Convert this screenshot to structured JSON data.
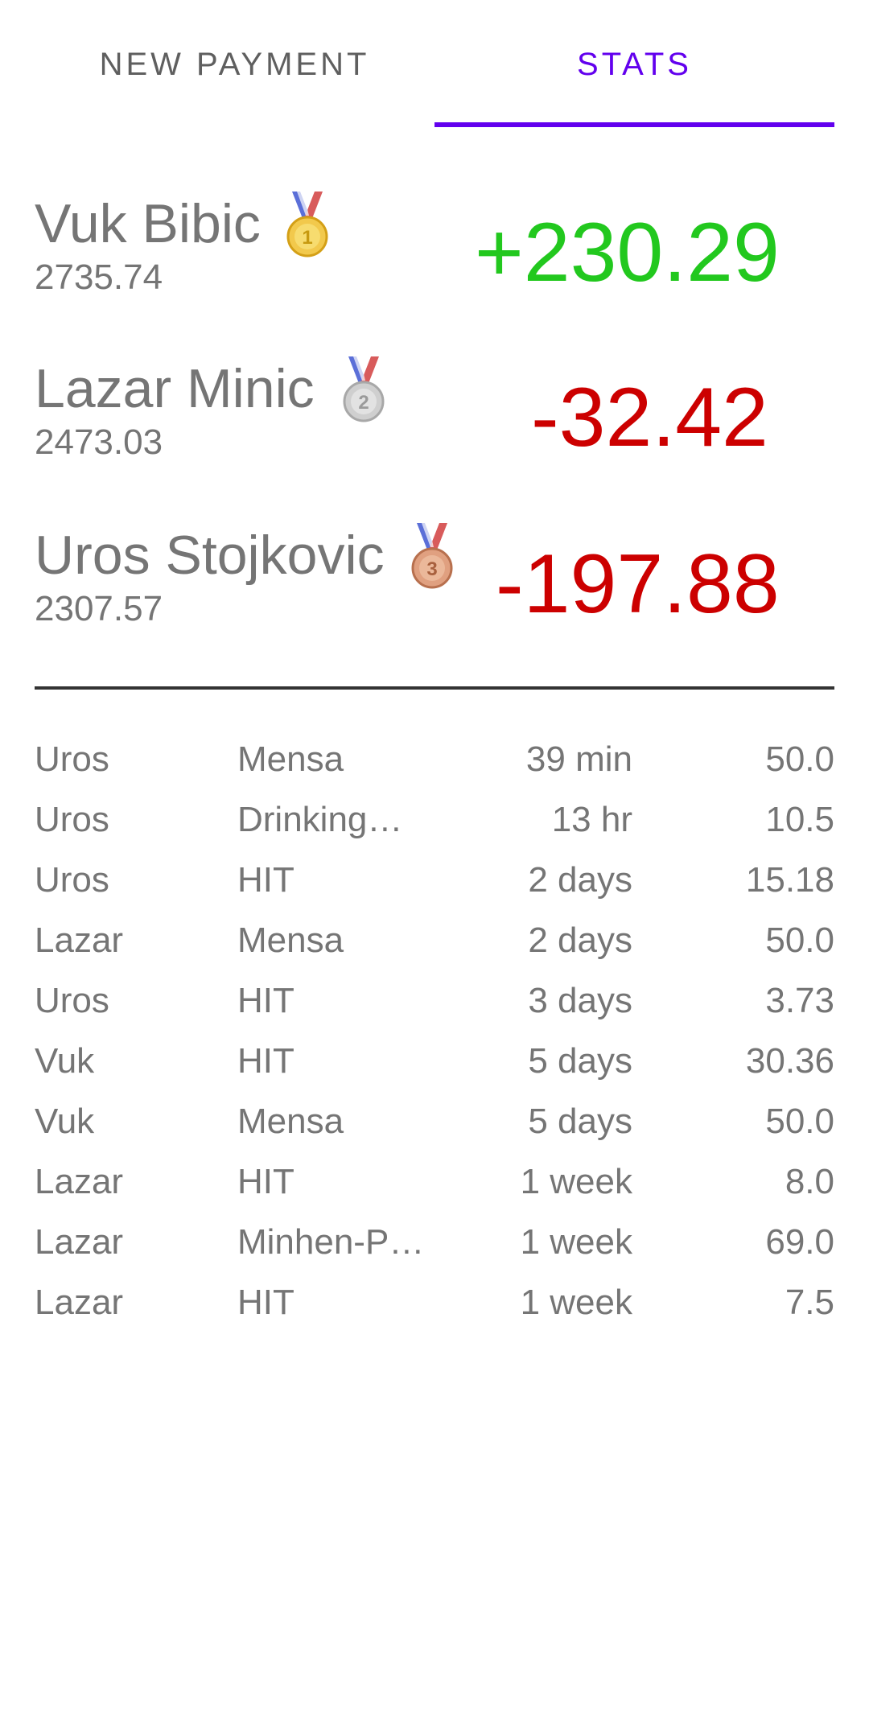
{
  "tabs": [
    {
      "label": "NEW PAYMENT",
      "selected": false
    },
    {
      "label": "STATS",
      "selected": true
    }
  ],
  "colors": {
    "accent": "#6200ee",
    "positive": "#22c81e",
    "negative": "#cc0000",
    "text": "#757575"
  },
  "leaderboard": [
    {
      "name": "Vuk Bibic",
      "total": "2735.74",
      "delta": "+230.29",
      "medal": "gold-medal-icon"
    },
    {
      "name": "Lazar Minic",
      "total": "2473.03",
      "delta": "-32.42",
      "medal": "silver-medal-icon"
    },
    {
      "name": "Uros Stojkovic",
      "total": "2307.57",
      "delta": "-197.88",
      "medal": "bronze-medal-icon"
    }
  ],
  "payments": [
    {
      "name": "Uros",
      "description": "Mensa",
      "time": "39 min",
      "amount": "50.0"
    },
    {
      "name": "Uros",
      "description": "Drinking…",
      "time": "13 hr",
      "amount": "10.5"
    },
    {
      "name": "Uros",
      "description": "HIT",
      "time": "2 days",
      "amount": "15.18"
    },
    {
      "name": "Lazar",
      "description": "Mensa",
      "time": "2 days",
      "amount": "50.0"
    },
    {
      "name": "Uros",
      "description": "HIT",
      "time": "3 days",
      "amount": "3.73"
    },
    {
      "name": "Vuk",
      "description": "HIT",
      "time": "5 days",
      "amount": "30.36"
    },
    {
      "name": "Vuk",
      "description": "Mensa",
      "time": "5 days",
      "amount": "50.0"
    },
    {
      "name": "Lazar",
      "description": "HIT",
      "time": "1 week",
      "amount": "8.0"
    },
    {
      "name": "Lazar",
      "description": "Minhen-Pr…",
      "time": "1 week",
      "amount": "69.0"
    },
    {
      "name": "Lazar",
      "description": "HIT",
      "time": "1 week",
      "amount": "7.5"
    }
  ]
}
